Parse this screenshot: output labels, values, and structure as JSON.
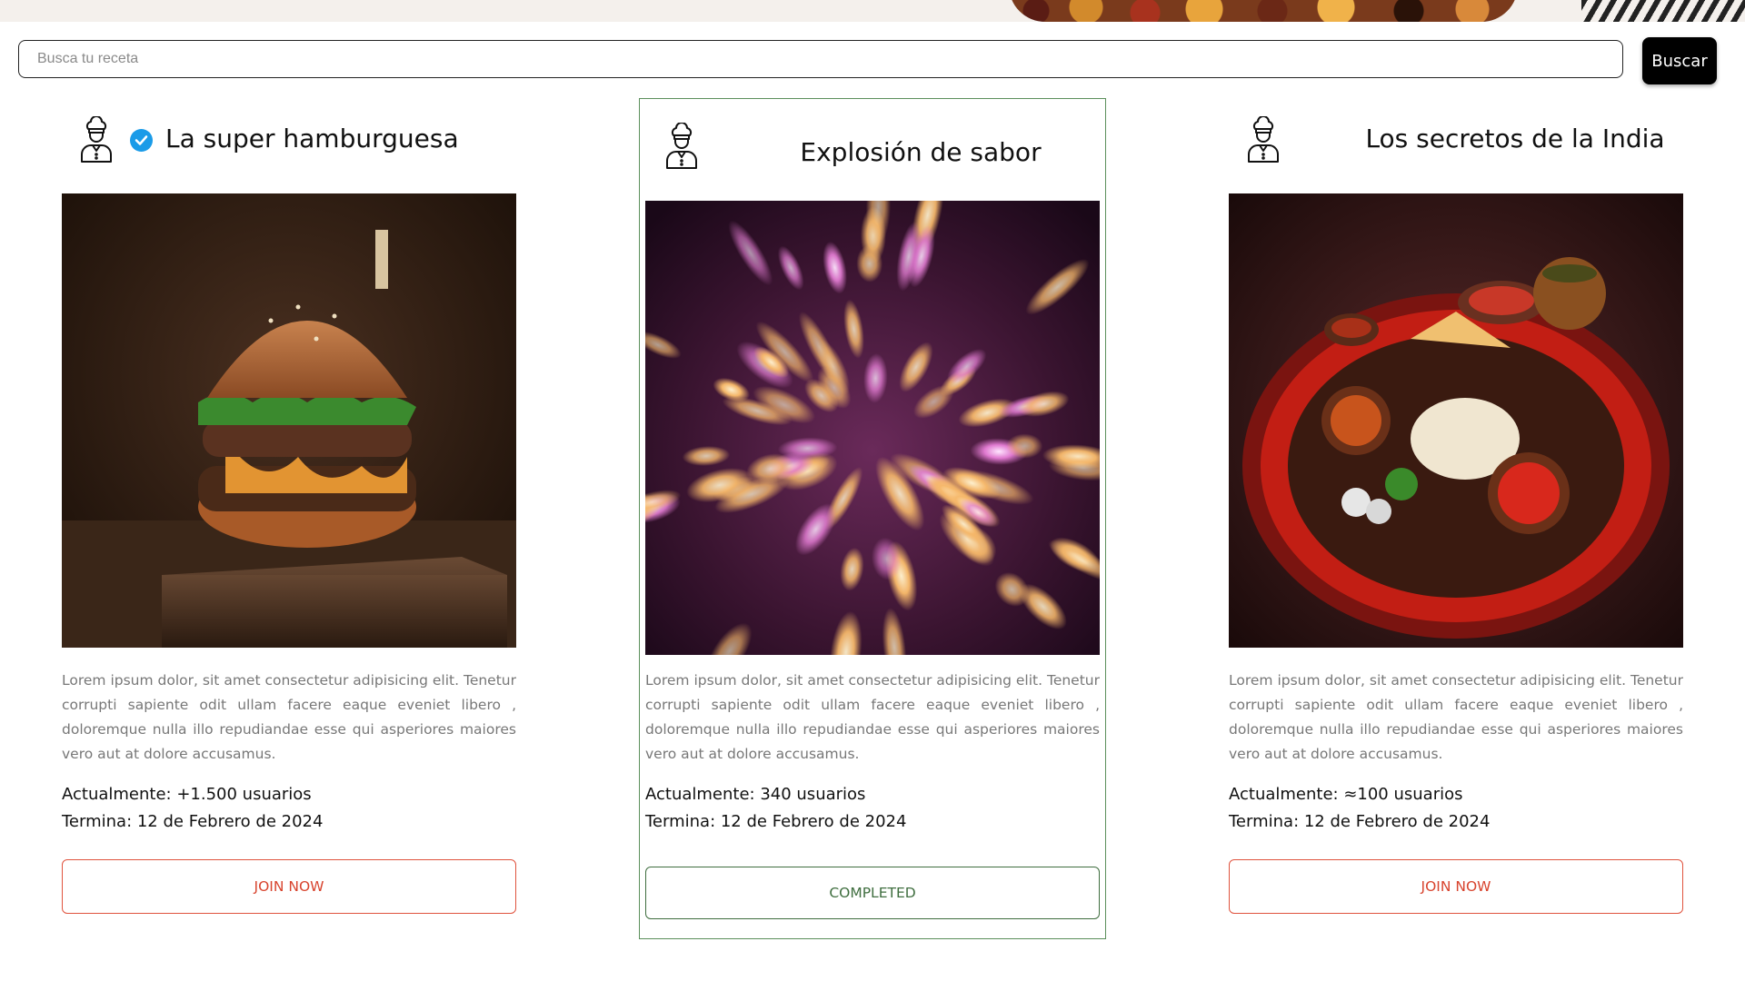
{
  "search": {
    "placeholder": "Busca tu receta",
    "button_label": "Buscar"
  },
  "colors": {
    "join_button": "#e0533e",
    "completed_button": "#3f6e3f",
    "verified_badge": "#1a9be8",
    "search_button_bg": "#000000"
  },
  "cards": [
    {
      "title": "La super hamburguesa",
      "verified": true,
      "chef_icon": "chef-icon",
      "image": "burger-photo",
      "description": "Lorem ipsum dolor, sit amet consectetur adipisicing elit. Tenetur corrupti sapiente odit ullam facere eaque eveniet libero , doloremque nulla illo repudiandae esse qui asperiores maiores vero aut at dolore accusamus.",
      "current": "Actualmente: +1.500 usuarios",
      "ends": "Termina: 12 de Febrero de 2024",
      "button_label": "JOIN NOW",
      "status": "open"
    },
    {
      "title": "Explosión de sabor",
      "verified": false,
      "chef_icon": "chef-icon",
      "image": "fireworks-photo",
      "description": "Lorem ipsum dolor, sit amet consectetur adipisicing elit. Tenetur corrupti sapiente odit ullam facere eaque eveniet libero , doloremque nulla illo repudiandae esse qui asperiores maiores vero aut at dolore accusamus.",
      "current": "Actualmente: 340 usuarios",
      "ends": "Termina: 12 de Febrero de 2024",
      "button_label": "COMPLETED",
      "status": "completed"
    },
    {
      "title": "Los secretos de la India",
      "verified": false,
      "chef_icon": "chef-icon",
      "image": "indian-thali-photo",
      "description": "Lorem ipsum dolor, sit amet consectetur adipisicing elit. Tenetur corrupti sapiente odit ullam facere eaque eveniet libero , doloremque nulla illo repudiandae esse qui asperiores maiores vero aut at dolore accusamus.",
      "current": "Actualmente: ≈100 usuarios",
      "ends": "Termina: 12 de Febrero de 2024",
      "button_label": "JOIN NOW",
      "status": "open"
    }
  ]
}
